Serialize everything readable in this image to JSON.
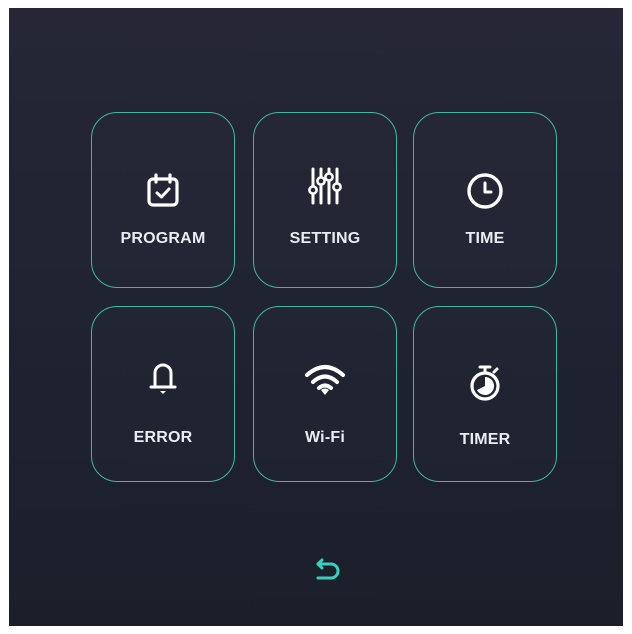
{
  "menu": {
    "tiles": [
      {
        "label": "PROGRAM",
        "icon": "calendar-check-icon"
      },
      {
        "label": "SETTING",
        "icon": "sliders-icon"
      },
      {
        "label": "TIME",
        "icon": "clock-icon"
      },
      {
        "label": "ERROR",
        "icon": "bell-icon"
      },
      {
        "label": "Wi-Fi",
        "icon": "wifi-icon"
      },
      {
        "label": "TIMER",
        "icon": "stopwatch-icon"
      }
    ]
  },
  "footer": {
    "back_icon": "back-arrow-icon"
  },
  "colors": {
    "background_top": "#262636",
    "background_bottom": "#1b1f2a",
    "tile_border": "#3fb7a2",
    "text": "#e9edf2",
    "accent": "#3ad0c0"
  }
}
